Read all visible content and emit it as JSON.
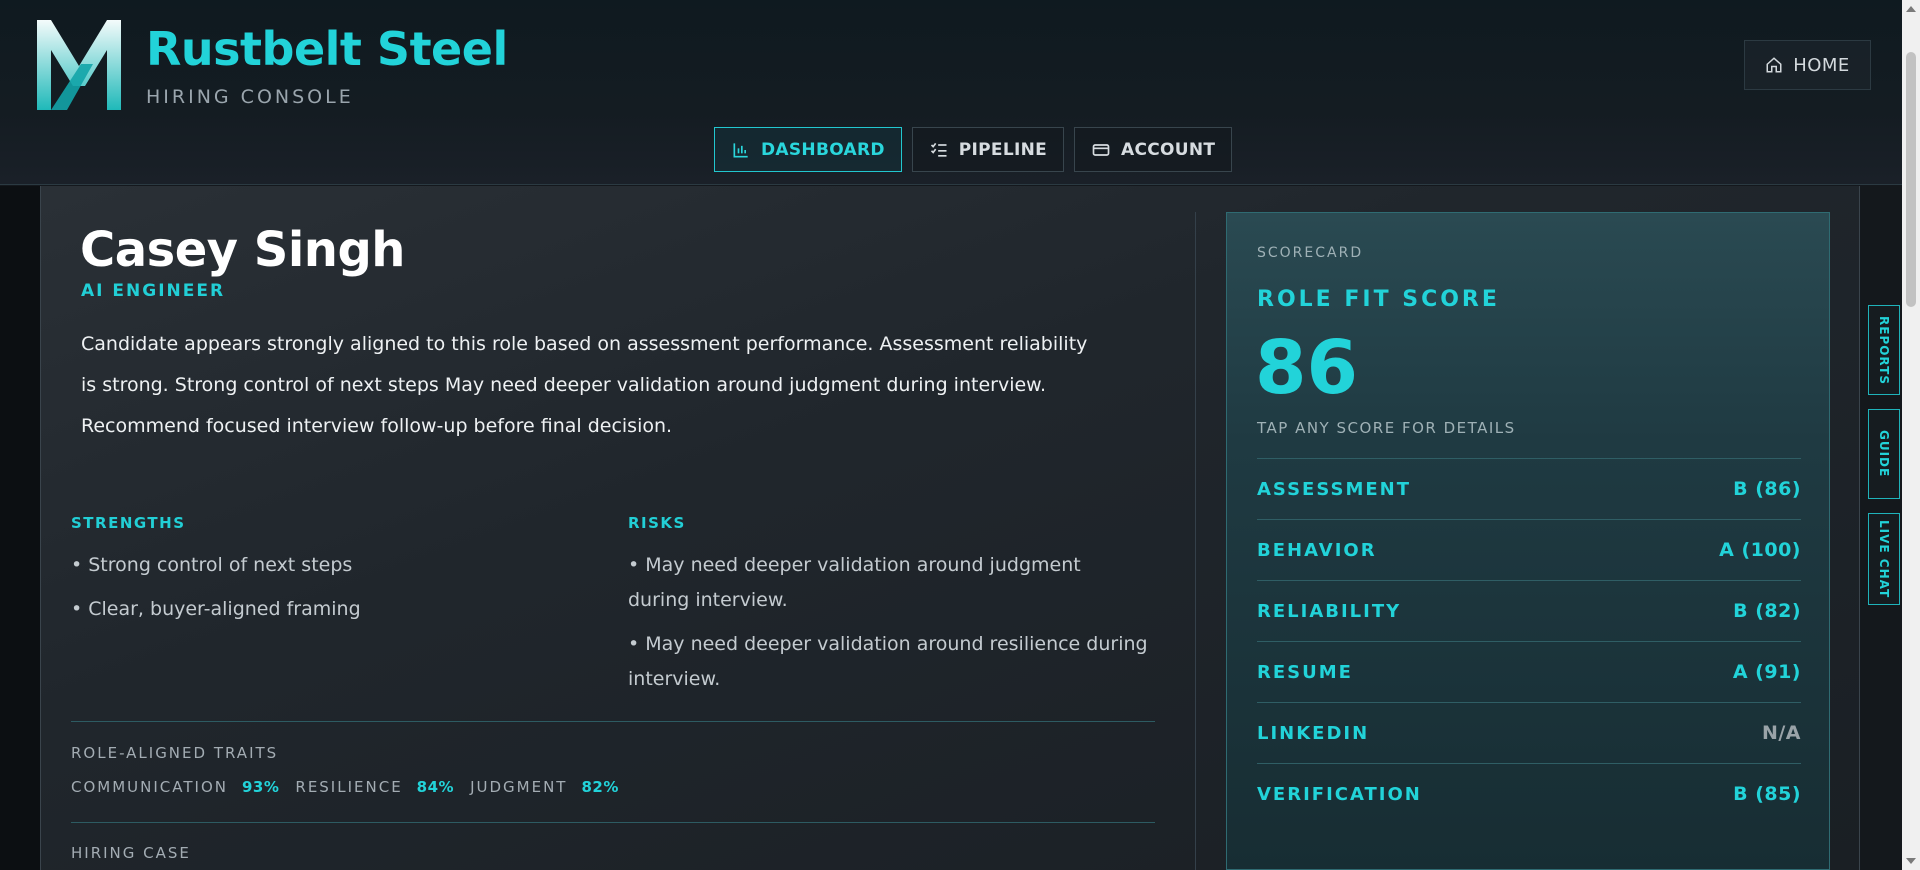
{
  "header": {
    "brand_title": "Rustbelt Steel",
    "brand_subtitle": "HIRING CONSOLE",
    "home_label": "HOME",
    "nav": [
      {
        "label": "DASHBOARD",
        "icon": "bar-chart-icon",
        "active": true
      },
      {
        "label": "PIPELINE",
        "icon": "checklist-icon",
        "active": false
      },
      {
        "label": "ACCOUNT",
        "icon": "card-icon",
        "active": false
      }
    ]
  },
  "candidate": {
    "name": "Casey Singh",
    "role": "AI ENGINEER",
    "summary": "Candidate appears strongly aligned to this role based on assessment performance. Assessment reliability is strong. Strong control of next steps May need deeper validation around judgment during interview. Recommend focused interview follow-up before final decision."
  },
  "strengths": {
    "heading": "STRENGTHS",
    "items": [
      "• Strong control of next steps",
      "• Clear, buyer-aligned framing"
    ]
  },
  "risks": {
    "heading": "RISKS",
    "items": [
      "• May need deeper validation around judgment during interview.",
      "• May need deeper validation around resilience during interview."
    ]
  },
  "traits": {
    "heading": "ROLE-ALIGNED TRAITS",
    "items": [
      {
        "name": "COMMUNICATION",
        "pct": "93%"
      },
      {
        "name": "RESILIENCE",
        "pct": "84%"
      },
      {
        "name": "JUDGMENT",
        "pct": "82%"
      }
    ]
  },
  "hiring_case": {
    "heading": "HIRING CASE"
  },
  "scorecard": {
    "label": "SCORECARD",
    "title": "ROLE FIT SCORE",
    "score": "86",
    "hint": "TAP ANY SCORE FOR DETAILS",
    "rows": [
      {
        "name": "ASSESSMENT",
        "value": "B (86)"
      },
      {
        "name": "BEHAVIOR",
        "value": "A (100)"
      },
      {
        "name": "RELIABILITY",
        "value": "B (82)"
      },
      {
        "name": "RESUME",
        "value": "A (91)"
      },
      {
        "name": "LINKEDIN",
        "value": "N/A"
      },
      {
        "name": "VERIFICATION",
        "value": "B (85)"
      }
    ]
  },
  "side_tabs": [
    "REPORTS",
    "GUIDE",
    "LIVE CHAT"
  ],
  "colors": {
    "accent": "#22d3d9",
    "background": "#1e2429"
  }
}
